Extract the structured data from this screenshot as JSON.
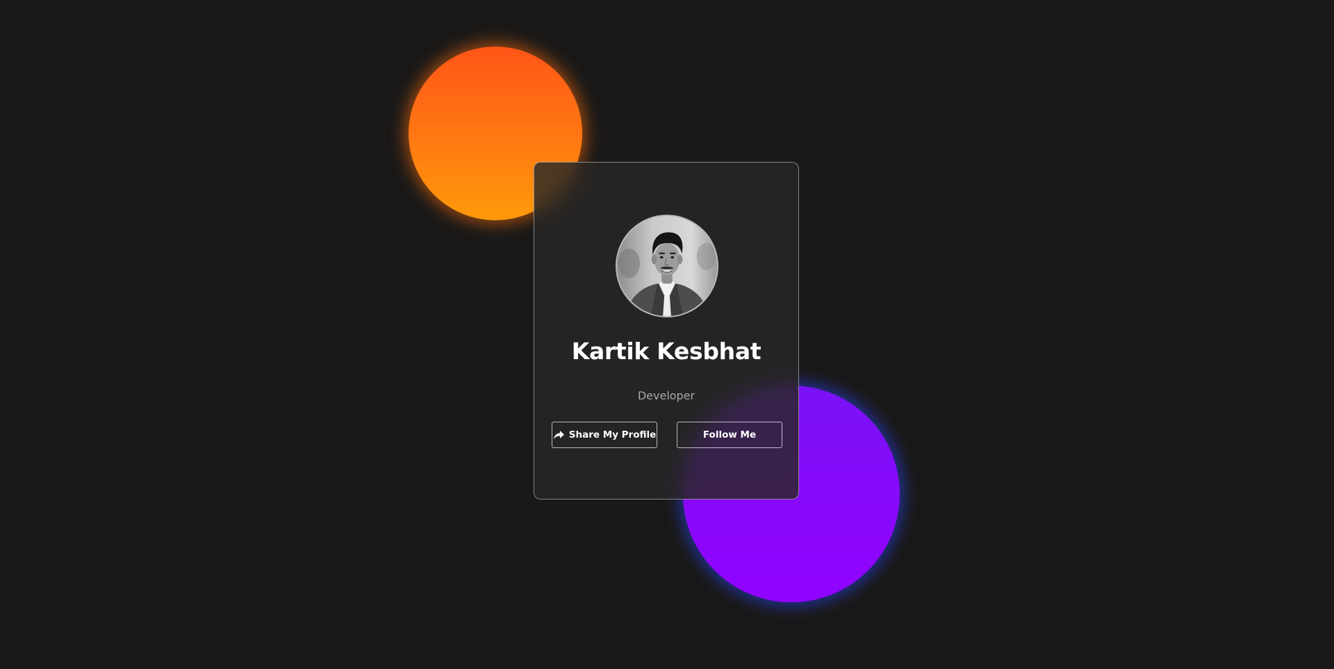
{
  "profile": {
    "name": "Kartik Kesbhat",
    "role": "Developer",
    "avatar_icon": "profile-photo"
  },
  "actions": {
    "share_label": "Share My Profile",
    "share_icon": "share-arrow-icon",
    "follow_label": "Follow Me"
  },
  "colors": {
    "background": "#1a1918",
    "orange_blob": "#ff6a12",
    "purple_blob": "#8a08fb",
    "text_primary": "#ffffff",
    "text_secondary": "#a9a9a9"
  }
}
